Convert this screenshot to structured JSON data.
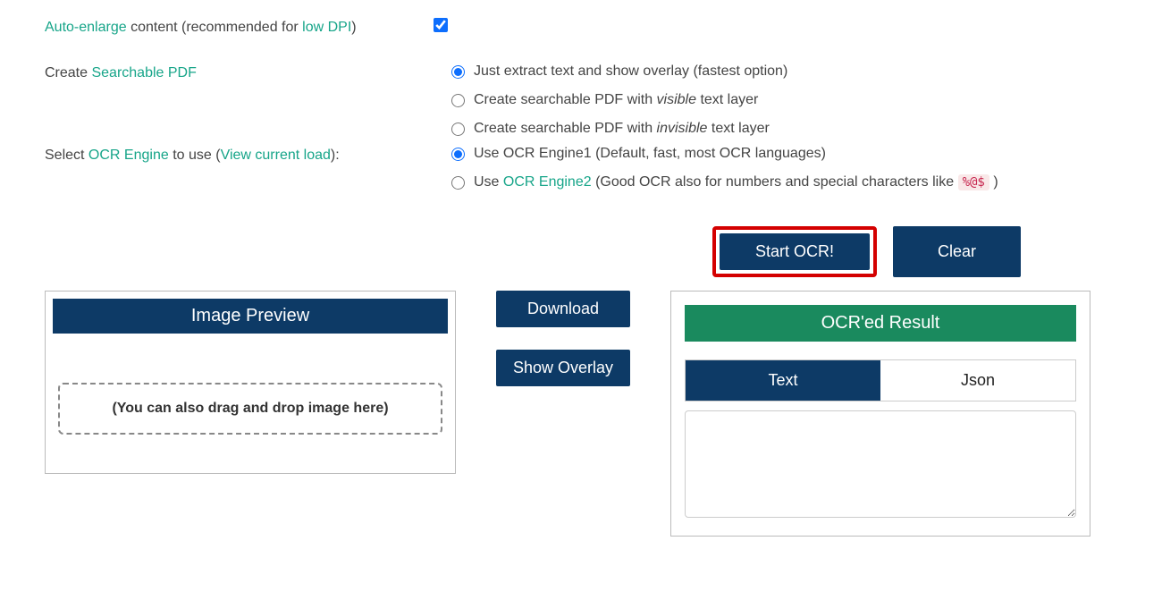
{
  "autoEnlarge": {
    "linkPrefix": "Auto-enlarge",
    "mid": " content (recommended for ",
    "linkSuffix": "low DPI",
    "end": ")",
    "checked": true
  },
  "searchablePdf": {
    "prefix": "Create ",
    "link": "Searchable PDF"
  },
  "pdfOptions": [
    {
      "label": "Just extract text and show overlay (fastest option)",
      "checked": true
    },
    {
      "labelBefore": "Create searchable PDF with ",
      "italic": "visible",
      "labelAfter": " text layer",
      "checked": false
    },
    {
      "labelBefore": "Create searchable PDF with ",
      "italic": "invisible",
      "labelAfter": " text layer",
      "checked": false
    }
  ],
  "engineSelect": {
    "prefix": "Select ",
    "link1": "OCR Engine",
    "mid": " to use (",
    "link2": "View current load",
    "end": "):"
  },
  "engineOptions": [
    {
      "label": "Use OCR Engine1 (Default, fast, most OCR languages)",
      "checked": true
    },
    {
      "prefix": "Use ",
      "link": "OCR Engine2",
      "suffix": " (Good OCR also for numbers and special characters like ",
      "code": "%@$",
      "end": " )",
      "checked": false
    }
  ],
  "buttons": {
    "start": "Start OCR!",
    "clear": "Clear",
    "download": "Download",
    "showOverlay": "Show Overlay"
  },
  "panels": {
    "preview": "Image Preview",
    "dropzone": "(You can also drag and drop image here)",
    "result": "OCR'ed Result"
  },
  "tabs": {
    "text": "Text",
    "json": "Json"
  },
  "resultValue": ""
}
